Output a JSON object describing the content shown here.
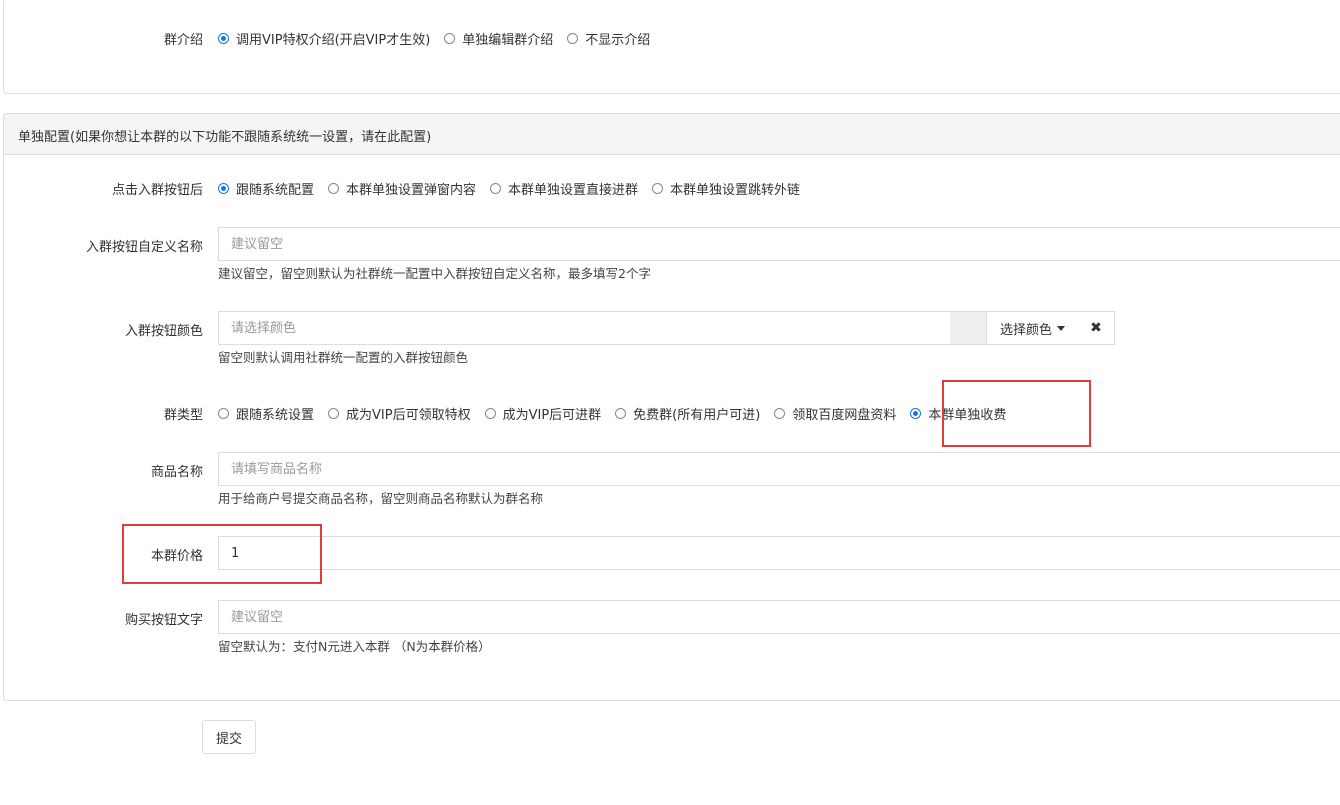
{
  "group_intro": {
    "label": "群介绍",
    "options": [
      "调用VIP特权介绍(开启VIP才生效)",
      "单独编辑群介绍",
      "不显示介绍"
    ],
    "selected": 0
  },
  "individual_config": {
    "heading": "单独配置(如果你想让本群的以下功能不跟随系统统一设置，请在此配置)"
  },
  "join_button_action": {
    "label": "点击入群按钮后",
    "options": [
      "跟随系统配置",
      "本群单独设置弹窗内容",
      "本群单独设置直接进群",
      "本群单独设置跳转外链"
    ],
    "selected": 0
  },
  "join_button_name": {
    "label": "入群按钮自定义名称",
    "placeholder": "建议留空",
    "value": "",
    "help": "建议留空，留空则默认为社群统一配置中入群按钮自定义名称，最多填写2个字"
  },
  "join_button_color": {
    "label": "入群按钮颜色",
    "placeholder": "请选择颜色",
    "value": "",
    "select_label": "选择颜色",
    "clear_icon": "close-icon",
    "help": "留空则默认调用社群统一配置的入群按钮颜色"
  },
  "group_type": {
    "label": "群类型",
    "options": [
      "跟随系统设置",
      "成为VIP后可领取特权",
      "成为VIP后可进群",
      "免费群(所有用户可进)",
      "领取百度网盘资料",
      "本群单独收费"
    ],
    "selected": 5
  },
  "product_name": {
    "label": "商品名称",
    "placeholder": "请填写商品名称",
    "value": "",
    "help": "用于给商户号提交商品名称，留空则商品名称默认为群名称"
  },
  "group_price": {
    "label": "本群价格",
    "value": "1"
  },
  "buy_button_text": {
    "label": "购买按钮文字",
    "placeholder": "建议留空",
    "value": "",
    "help": "留空默认为：支付N元进入本群 （N为本群价格）"
  },
  "submit_label": "提交",
  "colors": {
    "accent": "#1a73e8",
    "highlight": "#e03c3c",
    "border": "#dddddd",
    "panel_head_bg": "#f5f5f5"
  }
}
